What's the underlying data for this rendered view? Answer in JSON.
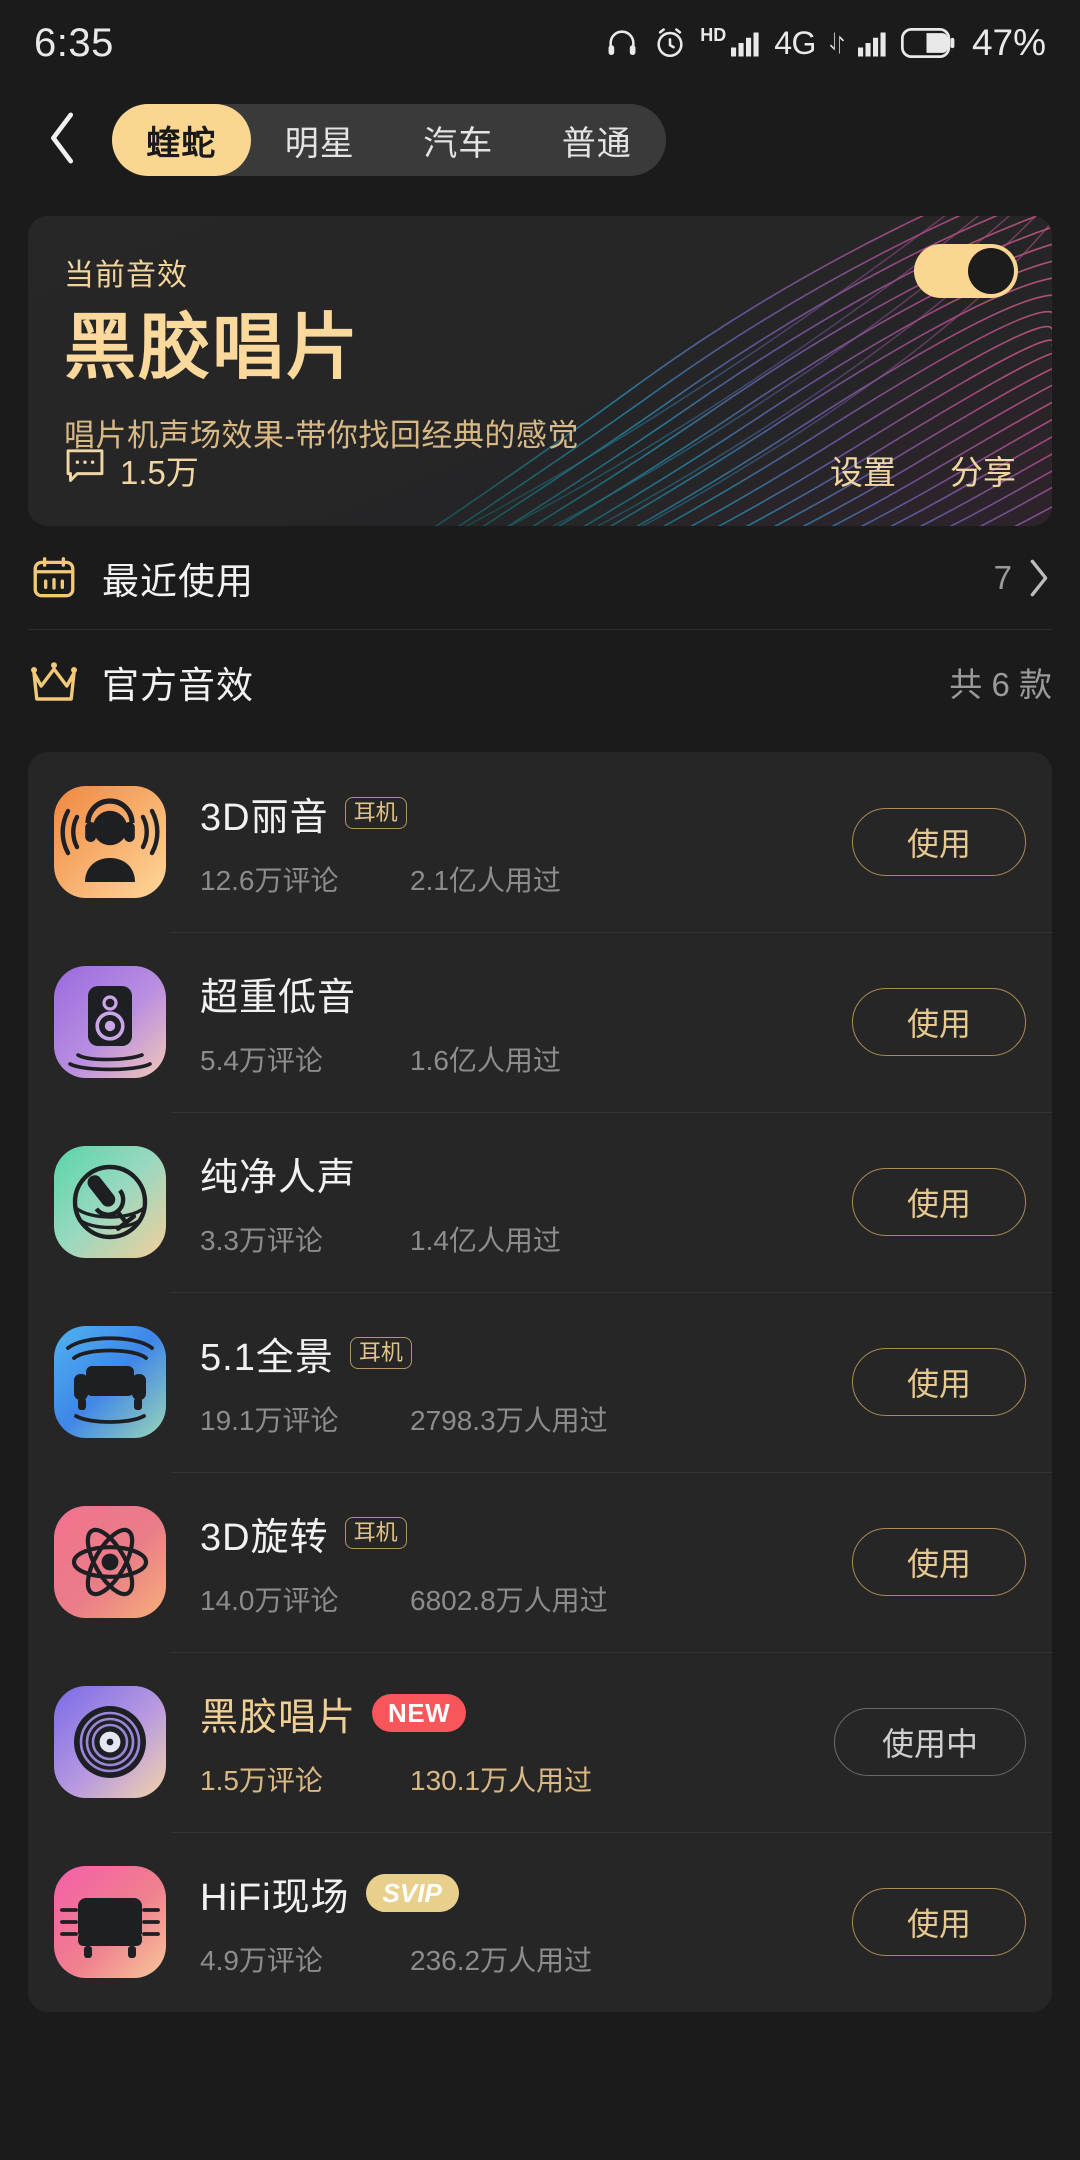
{
  "status_bar": {
    "time": "6:35",
    "hd_label": "HD",
    "network": "4G",
    "battery_percent": "47%",
    "icons": [
      "headphone-icon",
      "alarm-icon",
      "signal-icon",
      "signal-icon",
      "battery-icon"
    ]
  },
  "topbar": {
    "back_icon": "chevron-left-icon",
    "tabs": [
      {
        "label": "蝰蛇",
        "active": true
      },
      {
        "label": "明星",
        "active": false
      },
      {
        "label": "汽车",
        "active": false
      },
      {
        "label": "普通",
        "active": false
      }
    ]
  },
  "hero": {
    "label": "当前音效",
    "title": "黑胶唱片",
    "desc": "唱片机声场效果-带你找回经典的感觉",
    "comment_icon": "comment-icon",
    "comment_count": "1.5万",
    "settings_label": "设置",
    "share_label": "分享",
    "toggle_on": true,
    "accent": "#fbd690"
  },
  "sections": [
    {
      "icon": "calendar-icon",
      "title": "最近使用",
      "right": "7",
      "chevron": true
    },
    {
      "icon": "crown-icon",
      "title": "官方音效",
      "right": "共 6 款",
      "chevron": false
    }
  ],
  "effects": [
    {
      "icon": "person-headphones-icon",
      "name": "3D丽音",
      "name_gold": false,
      "badge": "耳机",
      "badge_type": "hp",
      "comments": "12.6万评论",
      "users": "2.1亿人用过",
      "meta_gold": false,
      "button": "使用",
      "in_use": false
    },
    {
      "icon": "speaker-icon",
      "name": "超重低音",
      "name_gold": false,
      "badge": "",
      "badge_type": "",
      "comments": "5.4万评论",
      "users": "1.6亿人用过",
      "meta_gold": false,
      "button": "使用",
      "in_use": false
    },
    {
      "icon": "microphone-icon",
      "name": "纯净人声",
      "name_gold": false,
      "badge": "",
      "badge_type": "",
      "comments": "3.3万评论",
      "users": "1.4亿人用过",
      "meta_gold": false,
      "button": "使用",
      "in_use": false
    },
    {
      "icon": "sofa-icon",
      "name": "5.1全景",
      "name_gold": false,
      "badge": "耳机",
      "badge_type": "hp",
      "comments": "19.1万评论",
      "users": "2798.3万人用过",
      "meta_gold": false,
      "button": "使用",
      "in_use": false
    },
    {
      "icon": "atom-icon",
      "name": "3D旋转",
      "name_gold": false,
      "badge": "耳机",
      "badge_type": "hp",
      "comments": "14.0万评论",
      "users": "6802.8万人用过",
      "meta_gold": false,
      "button": "使用",
      "in_use": false
    },
    {
      "icon": "vinyl-record-icon",
      "name": "黑胶唱片",
      "name_gold": true,
      "badge": "NEW",
      "badge_type": "new",
      "comments": "1.5万评论",
      "users": "130.1万人用过",
      "meta_gold": true,
      "button": "使用中",
      "in_use": true
    },
    {
      "icon": "armchair-icon",
      "name": "HiFi现场",
      "name_gold": false,
      "badge": "SVIP",
      "badge_type": "svip",
      "comments": "4.9万评论",
      "users": "236.2万人用过",
      "meta_gold": false,
      "button": "使用",
      "in_use": false
    }
  ]
}
